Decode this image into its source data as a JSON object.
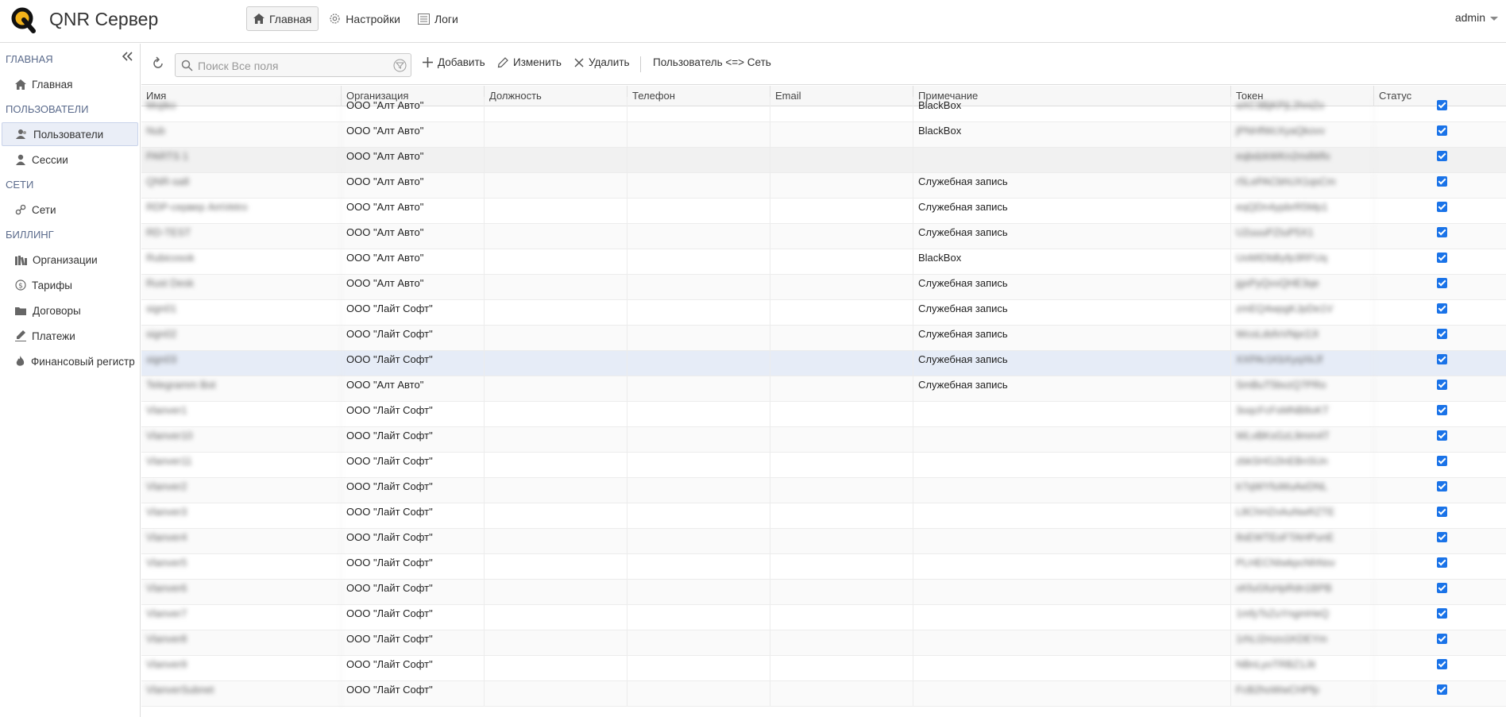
{
  "app": {
    "title": "QNR Сервер"
  },
  "topnav": [
    {
      "label": "Главная",
      "icon": "home-icon",
      "active": true
    },
    {
      "label": "Настройки",
      "icon": "gear-icon",
      "active": false
    },
    {
      "label": "Логи",
      "icon": "list-icon",
      "active": false
    }
  ],
  "user": {
    "name": "admin"
  },
  "sidebar": {
    "sections": [
      {
        "title": "ГЛАВНАЯ",
        "items": [
          {
            "label": "Главная",
            "icon": "home-icon"
          }
        ]
      },
      {
        "title": "ПОЛЬЗОВАТЕЛИ",
        "items": [
          {
            "label": "Пользователи",
            "icon": "users-icon",
            "active": true
          },
          {
            "label": "Сессии",
            "icon": "user-icon"
          }
        ]
      },
      {
        "title": "СЕТИ",
        "items": [
          {
            "label": "Сети",
            "icon": "link-icon"
          }
        ]
      },
      {
        "title": "БИЛЛИНГ",
        "items": [
          {
            "label": "Организации",
            "icon": "library-icon"
          },
          {
            "label": "Тарифы",
            "icon": "dollar-icon"
          },
          {
            "label": "Договоры",
            "icon": "folder-icon"
          },
          {
            "label": "Платежи",
            "icon": "pen-icon"
          },
          {
            "label": "Финансовый регистр",
            "icon": "fire-icon"
          }
        ]
      }
    ]
  },
  "toolbar": {
    "search_placeholder": "Поиск Все поля",
    "add_label": "Добавить",
    "edit_label": "Изменить",
    "delete_label": "Удалить",
    "link_label": "Пользователь <=> Сеть"
  },
  "columns": [
    "Имя",
    "Организация",
    "Должность",
    "Телефон",
    "Email",
    "Примечание",
    "Токен",
    "Статус"
  ],
  "rows": [
    {
      "name": "Mojiko",
      "org": "ООО \"Алт Авто\"",
      "note": "BlackBox",
      "token": "aXC3BjKPjL2hniZo",
      "status": true
    },
    {
      "name": "Nub",
      "org": "ООО \"Алт Авто\"",
      "note": "BlackBox",
      "token": "jPNHfWcXyaQkovv",
      "status": true
    },
    {
      "name": "PARTS 1",
      "org": "ООО \"Алт Авто\"",
      "note": "",
      "token": "eqbdzkWKn2mdWfo",
      "status": true
    },
    {
      "name": "QNR-sa8",
      "org": "ООО \"Алт Авто\"",
      "note": "Служебная запись",
      "token": "r5LePACbhUX1qsCm",
      "status": true
    },
    {
      "name": "RDP-сервер AmVetro",
      "org": "ООО \"Алт Авто\"",
      "note": "Служебная запись",
      "token": "eqQDn4ypbrR5Mp1",
      "status": true
    },
    {
      "name": "RD-TEST",
      "org": "ООО \"Алт Авто\"",
      "note": "Служебная запись",
      "token": "U2uuuPZIuP5X1",
      "status": true
    },
    {
      "name": "Rubicosok",
      "org": "ООО \"Алт Авто\"",
      "note": "BlackBox",
      "token": "UoMIDbByfp3RFUq",
      "status": true
    },
    {
      "name": "Rust Desk",
      "org": "ООО \"Алт Авто\"",
      "note": "Служебная запись",
      "token": "jgxPyQvvQHE3qe",
      "status": true
    },
    {
      "name": "sign01",
      "org": "ООО \"Лайт Софт\"",
      "note": "Служебная запись",
      "token": "zmEQ4wpgKJpDe1V",
      "status": true
    },
    {
      "name": "sign02",
      "org": "ООО \"Лайт Софт\"",
      "note": "Служебная запись",
      "token": "WcoLdsfvVNpr2JI",
      "status": true
    },
    {
      "name": "sign03",
      "org": "ООО \"Лайт Софт\"",
      "note": "Служебная запись",
      "token": "XXPAr1KbXyqXkJf",
      "status": true
    },
    {
      "name": "Telegramm Bot",
      "org": "ООО \"Алт Авто\"",
      "note": "Служебная запись",
      "token": "SmBuT5bvzQ7PRo",
      "status": true
    },
    {
      "name": "Vlanver1",
      "org": "ООО \"Лайт Софт\"",
      "note": "",
      "token": "3oqcFcFsMNB8oKT",
      "status": true
    },
    {
      "name": "Vlanver10",
      "org": "ООО \"Лайт Софт\"",
      "note": "",
      "token": "WLvBKsGzL9mm4T",
      "status": true
    },
    {
      "name": "Vlanver11",
      "org": "ООО \"Лайт Софт\"",
      "note": "",
      "token": "zbkSHG2lnEBnSUn",
      "status": true
    },
    {
      "name": "Vlanver2",
      "org": "ООО \"Лайт Софт\"",
      "note": "",
      "token": "tr7qWYfuWuAeDNL",
      "status": true
    },
    {
      "name": "Vlanver3",
      "org": "ООО \"Лайт Софт\"",
      "note": "",
      "token": "L8ChHZnAuNwRZTE",
      "status": true
    },
    {
      "name": "Vlanver4",
      "org": "ООО \"Лайт Софт\"",
      "note": "",
      "token": "8sEWTEoFTAHPunE",
      "status": true
    },
    {
      "name": "Vlanver5",
      "org": "ООО \"Лайт Софт\"",
      "note": "",
      "token": "PLHECNIwkpcNhNsv",
      "status": true
    },
    {
      "name": "Vlanver6",
      "org": "ООО \"Лайт Софт\"",
      "note": "",
      "token": "xKfuGfuHpRdn1BPB",
      "status": true
    },
    {
      "name": "Vlanver7",
      "org": "ООО \"Лайт Софт\"",
      "note": "",
      "token": "1mfyTsZuYngmHeQ",
      "status": true
    },
    {
      "name": "Vlanver8",
      "org": "ООО \"Лайт Софт\"",
      "note": "",
      "token": "1rhLI2mzo1KDEYm",
      "status": true
    },
    {
      "name": "Vlanver9",
      "org": "ООО \"Лайт Софт\"",
      "note": "",
      "token": "NBnLyoTRBZ1Jit",
      "status": true
    },
    {
      "name": "VlanverSubnet",
      "org": "ООО \"Лайт Софт\"",
      "note": "",
      "token": "FcB2hoWwCHPfp",
      "status": true
    }
  ],
  "colors": {
    "accent": "#1a73e8",
    "selected_row": "#e6ecf7",
    "section_title": "#5b6b8c"
  }
}
